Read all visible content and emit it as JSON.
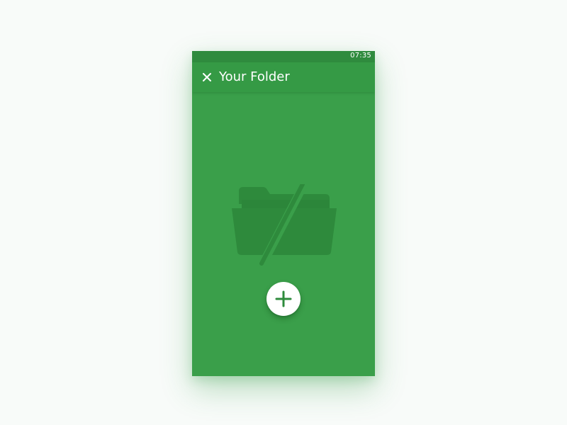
{
  "status_bar": {
    "time": "07:35"
  },
  "app_bar": {
    "title": "Your Folder",
    "close_icon": "close-icon"
  },
  "empty_state": {
    "icon": "folder-off-icon"
  },
  "fab": {
    "icon": "add-icon"
  },
  "colors": {
    "primary": "#3a9f4a",
    "primary_dark": "#2f8b3e",
    "app_bar": "#359a45",
    "icon_muted": "#2e8a3c",
    "fab_background": "#ffffff",
    "fab_icon": "#2e8b3c"
  }
}
